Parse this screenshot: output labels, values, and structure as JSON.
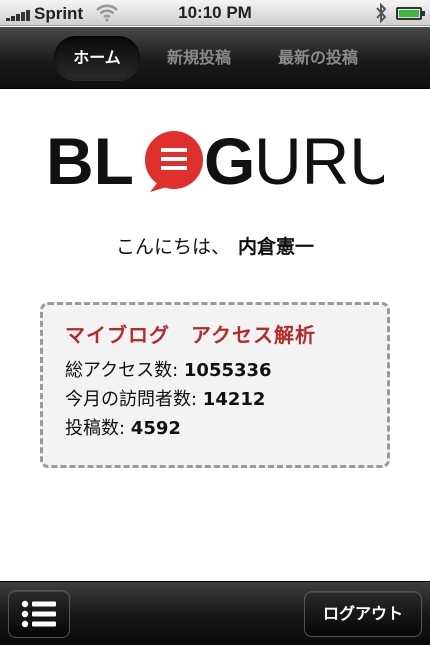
{
  "status_bar": {
    "carrier": "Sprint",
    "time": "10:10 PM",
    "signal_bars": 5
  },
  "nav": {
    "tabs": [
      {
        "label": "ホーム",
        "active": true
      },
      {
        "label": "新規投稿",
        "active": false
      },
      {
        "label": "最新の投稿",
        "active": false
      }
    ]
  },
  "logo": {
    "parts": [
      "BL",
      "G",
      "URU"
    ],
    "accent_color": "#e0302c"
  },
  "greeting": {
    "text": "こんにちは、",
    "user_name": "内倉憲一"
  },
  "stats": {
    "title": "マイブログ　アクセス解析",
    "title_color": "#b52a2a",
    "rows": [
      {
        "label": "総アクセス数: ",
        "value": "1055336"
      },
      {
        "label": "今月の訪問者数: ",
        "value": "14212"
      },
      {
        "label": "投稿数: ",
        "value": "4592"
      }
    ]
  },
  "toolbar": {
    "menu_icon": "list-icon",
    "logout_label": "ログアウト"
  }
}
